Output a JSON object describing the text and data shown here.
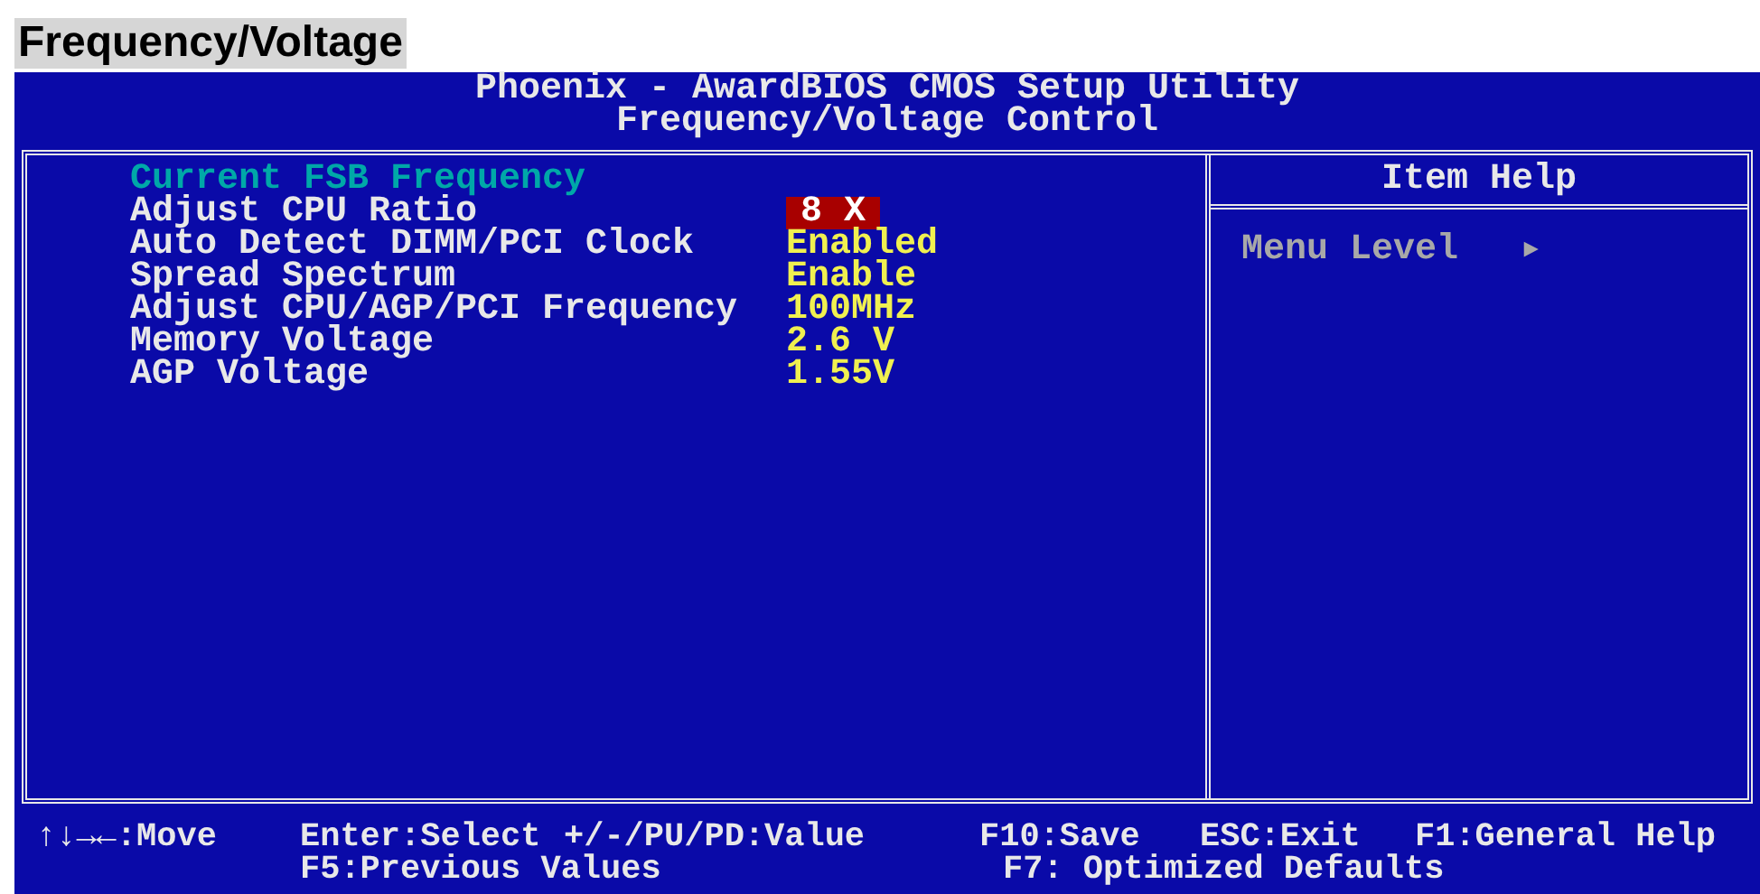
{
  "heading": "Frequency/Voltage",
  "header": {
    "title": "Phoenix - AwardBIOS CMOS Setup Utility",
    "subtitle": "Frequency/Voltage Control"
  },
  "items": [
    {
      "kind": "info",
      "label": "Current FSB Frequency",
      "selected": false
    },
    {
      "kind": "setting",
      "label": "Adjust CPU Ratio",
      "value": "8 X",
      "selected": true
    },
    {
      "kind": "setting",
      "label": "Auto Detect DIMM/PCI Clock",
      "value": "Enabled",
      "selected": false
    },
    {
      "kind": "setting",
      "label": "Spread Spectrum",
      "value": "Enable",
      "selected": false
    },
    {
      "kind": "setting",
      "label": "Adjust CPU/AGP/PCI Frequency",
      "value": "100MHz",
      "selected": false
    },
    {
      "kind": "setting",
      "label": "Memory Voltage",
      "value": "2.6 V",
      "selected": false
    },
    {
      "kind": "setting",
      "label": "AGP Voltage",
      "value": "1.55V",
      "selected": false
    }
  ],
  "help": {
    "title": "Item Help",
    "menu_level": "Menu Level",
    "arrow": "►"
  },
  "footer": {
    "row_1": [
      "↑↓→←:Move",
      "Enter:Select",
      "+/-/PU/PD:Value",
      "F10:Save",
      "ESC:Exit",
      "F1:General Help"
    ],
    "row_2": [
      "F5:Previous Values",
      "F7: Optimized Defaults"
    ]
  }
}
